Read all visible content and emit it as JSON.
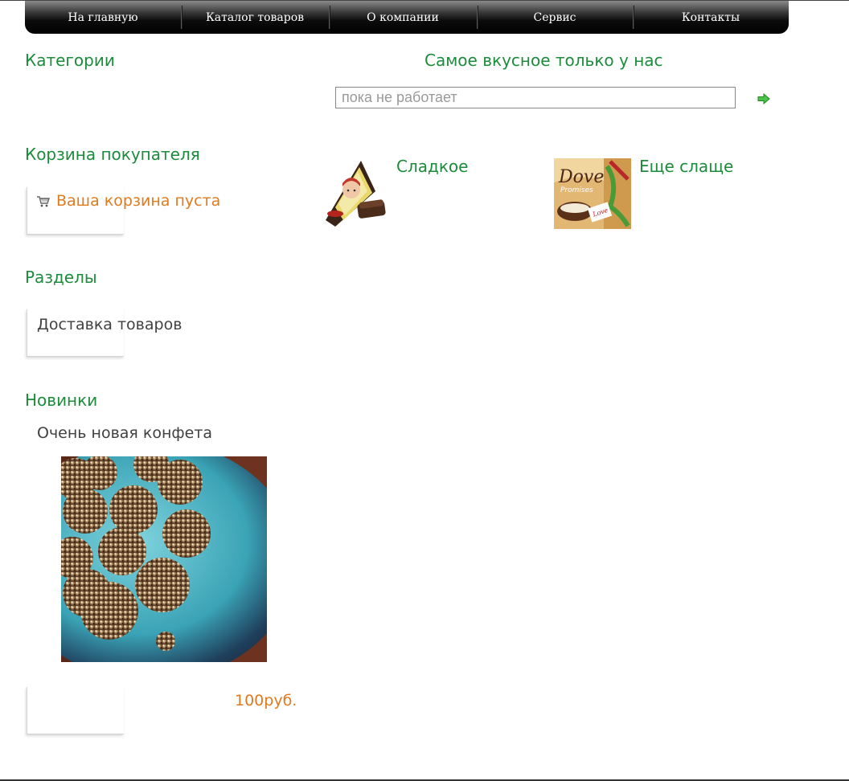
{
  "nav": {
    "items": [
      {
        "label": "На главную"
      },
      {
        "label": "Каталог товаров"
      },
      {
        "label": "О компании"
      },
      {
        "label": "Сервис"
      },
      {
        "label": "Контакты"
      }
    ]
  },
  "left": {
    "categories_title": "Категории",
    "cart_title": "Корзина покупателя",
    "cart_empty": "Ваша корзина пуста",
    "sections_title": "Разделы",
    "sections_items": [
      "Доставка товаров"
    ],
    "new_title": "Новинки",
    "new_product_name": "Очень новая конфета",
    "new_product_price": "100руб."
  },
  "main": {
    "tagline": "Самое вкусное только у нас",
    "search": {
      "placeholder": "пока не работает",
      "value": ""
    },
    "categories": [
      {
        "label": "Сладкое",
        "icon": "candy-alenka-thumbnail"
      },
      {
        "label": "Еще слаще",
        "icon": "dove-promises-thumbnail"
      }
    ]
  },
  "colors": {
    "accent_green": "#1c8c3c",
    "accent_orange": "#e07a20",
    "nav_bg": "#000000",
    "text": "#404040"
  }
}
